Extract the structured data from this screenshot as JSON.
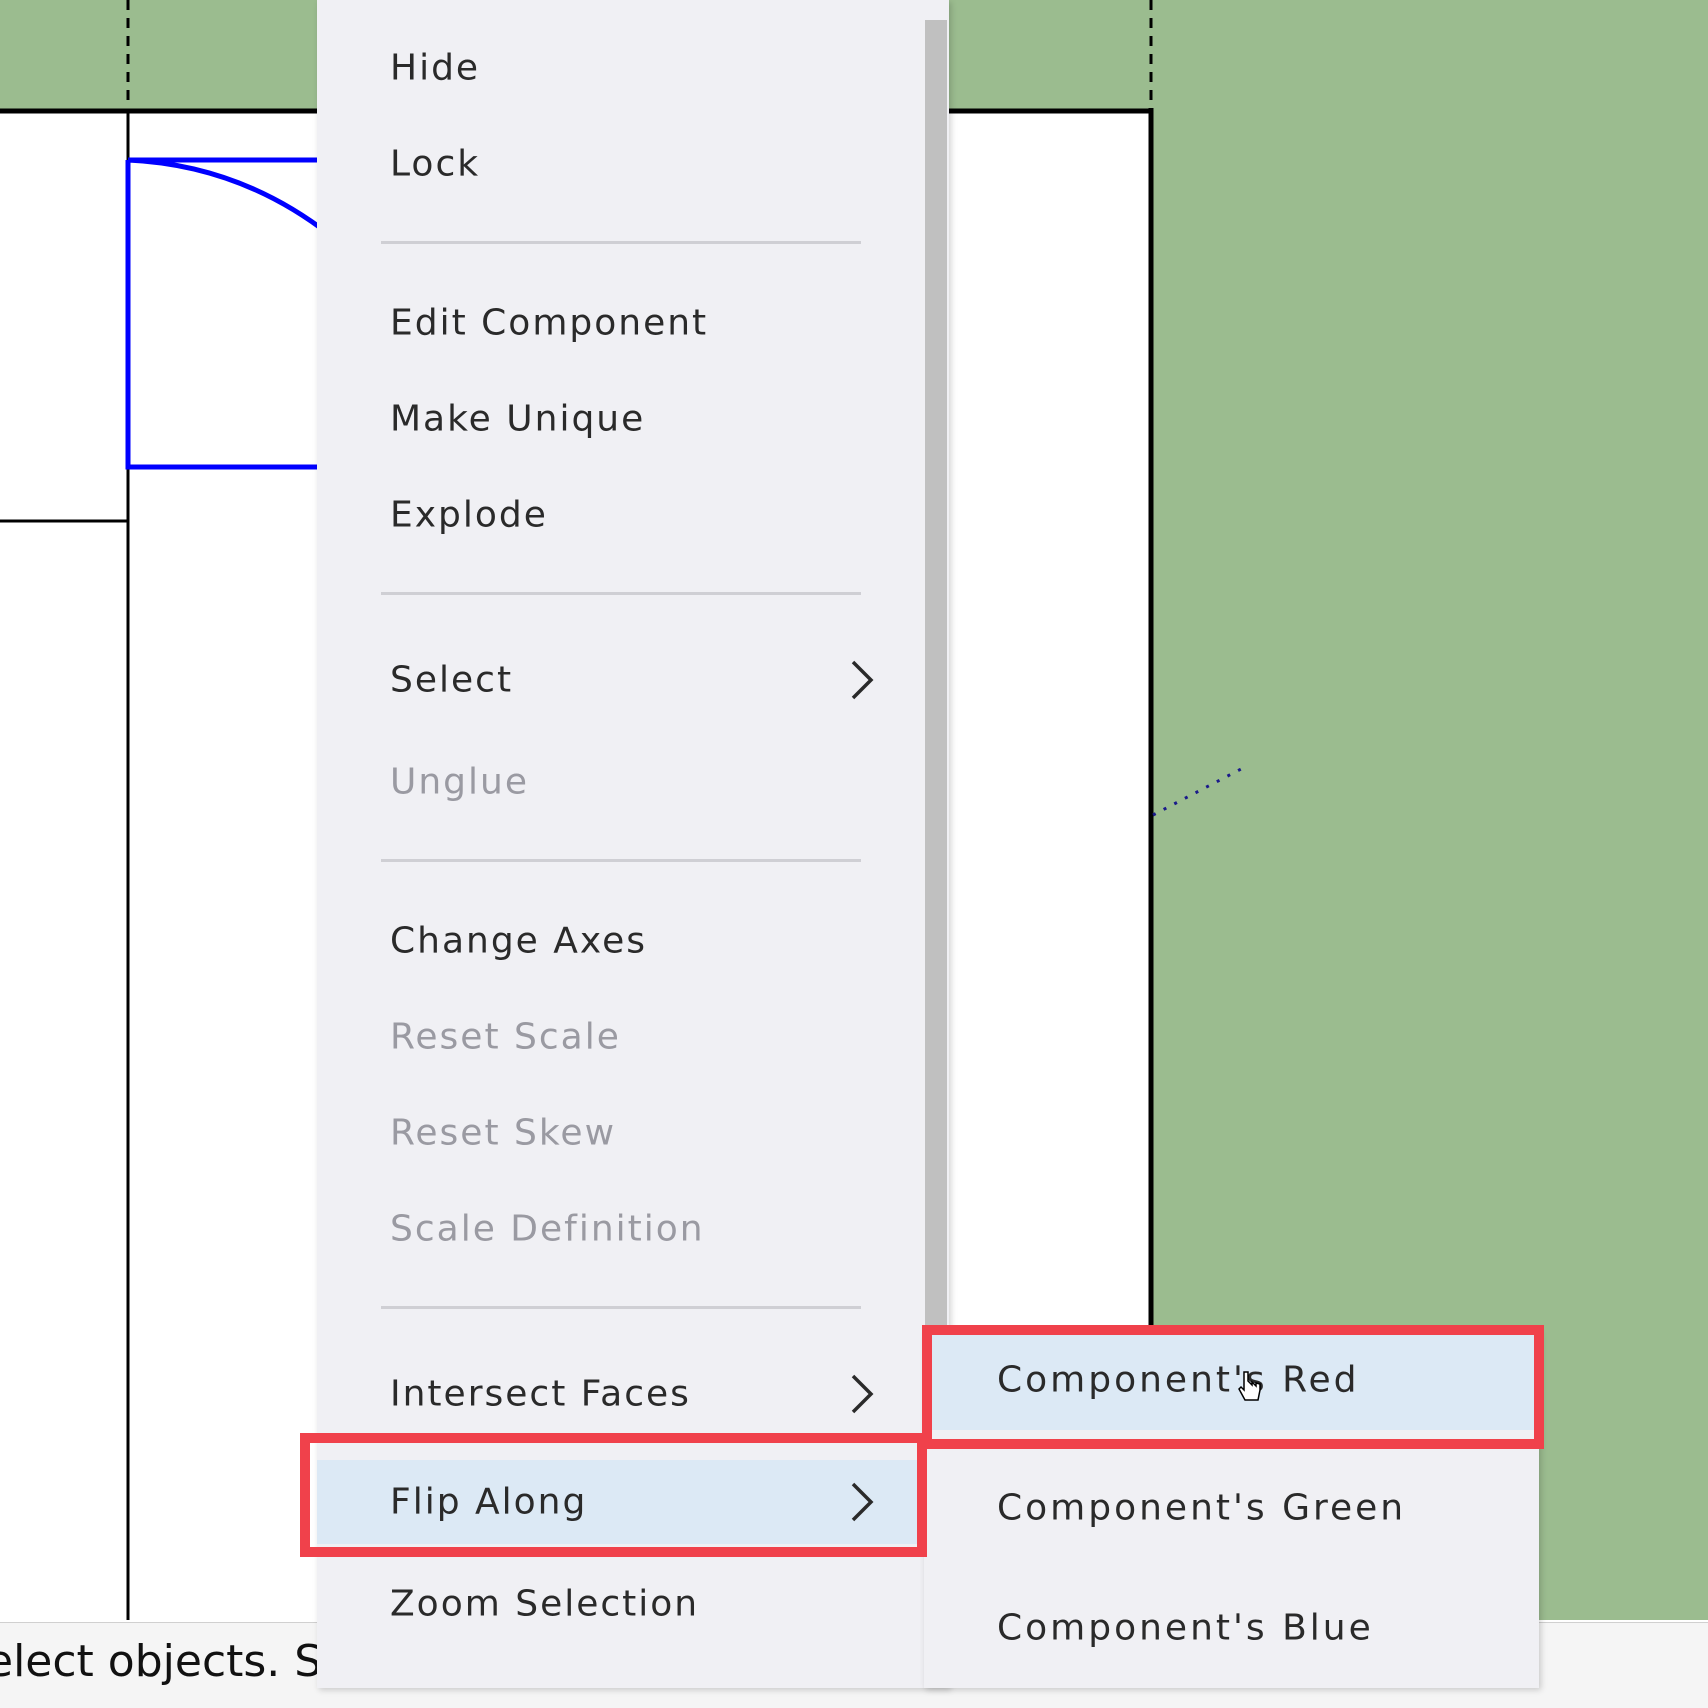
{
  "colors": {
    "ground": "#9bbc8f",
    "canvas": "#ffffff",
    "edge": "#000000",
    "selection": "#0000ff",
    "menu_bg": "#f0f0f4",
    "menu_highlight": "#dce9f5",
    "annotation": "#f0414b"
  },
  "status": {
    "text": "elect objects. Shift"
  },
  "context_menu": {
    "items": {
      "hide": "Hide",
      "lock": "Lock",
      "edit_component": "Edit Component",
      "make_unique": "Make Unique",
      "explode": "Explode",
      "select": "Select",
      "unglue": "Unglue",
      "change_axes": "Change Axes",
      "reset_scale": "Reset Scale",
      "reset_skew": "Reset Skew",
      "scale_definition": "Scale Definition",
      "intersect_faces": "Intersect Faces",
      "flip_along": "Flip Along",
      "zoom_selection": "Zoom Selection"
    },
    "disabled": [
      "Unglue",
      "Reset Scale",
      "Reset Skew",
      "Scale Definition"
    ],
    "highlighted": "Flip Along"
  },
  "submenu": {
    "parent": "Flip Along",
    "items": [
      "Component's Red",
      "Component's Green",
      "Component's Blue"
    ],
    "highlighted": "Component's Red"
  },
  "icons": [
    "chevron-right-icon",
    "hand-cursor-icon"
  ]
}
